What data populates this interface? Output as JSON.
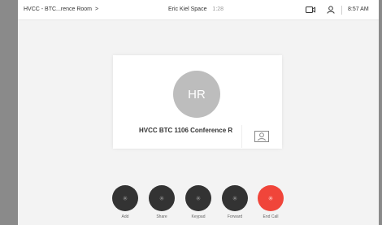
{
  "header": {
    "breadcrumb": "HVCC - BTC...rence Room",
    "breadcrumb_chevron": ">",
    "call_title": "Eric Kiel Space",
    "call_timer": "1:28",
    "time": "8:57 AM",
    "icons": [
      "video-camera-icon",
      "user-icon"
    ]
  },
  "participant": {
    "initials": "HR",
    "name": "HVCC BTC 1106 Conference R",
    "avatar_color": "#bdbdbd"
  },
  "controls": [
    {
      "label": "Add",
      "icon": "asterisk-icon"
    },
    {
      "label": "Share",
      "icon": "asterisk-icon"
    },
    {
      "label": "Keypad",
      "icon": "asterisk-icon"
    },
    {
      "label": "Forward",
      "icon": "asterisk-icon"
    },
    {
      "label": "End Call",
      "icon": "asterisk-icon",
      "color": "#f0453a"
    }
  ]
}
